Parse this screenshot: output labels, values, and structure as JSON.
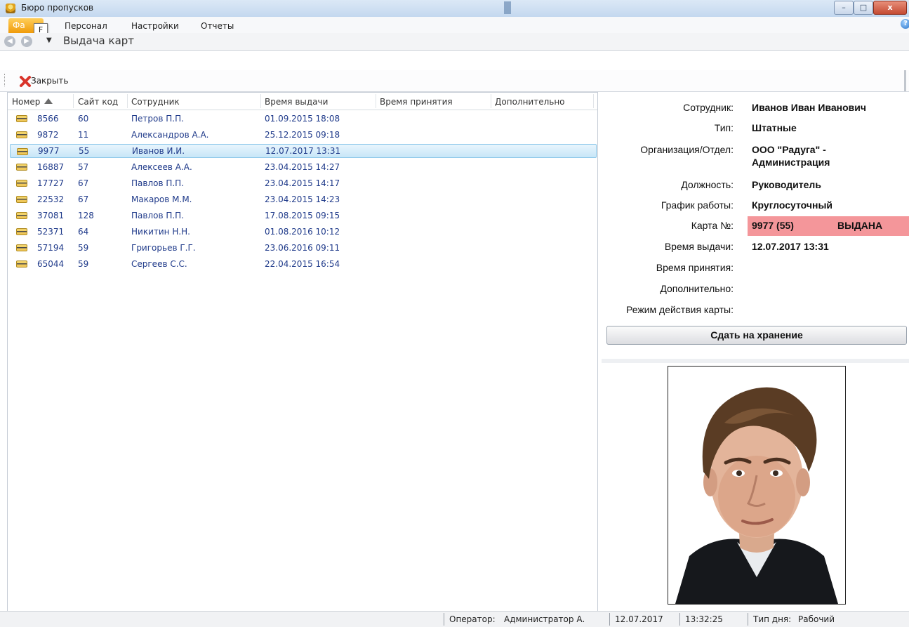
{
  "window": {
    "title": "Бюро пропусков"
  },
  "menu": {
    "file_label": "Фа",
    "file_keytip": "F",
    "tabs": [
      "Персонал",
      "Настройки",
      "Отчеты"
    ]
  },
  "navigation": {
    "page_title": "Выдача карт"
  },
  "toolbar": {
    "close_label": "Закрыть"
  },
  "grid": {
    "columns": [
      "Номер",
      "Сайт код",
      "Сотрудник",
      "Время выдачи",
      "Время принятия",
      "Дополнительно"
    ],
    "sort_column": "Номер",
    "rows": [
      {
        "number": "8566",
        "site": "60",
        "employee": "Петров П.П.",
        "issued": "01.09.2015 18:08"
      },
      {
        "number": "9872",
        "site": "11",
        "employee": "Александров А.А.",
        "issued": "25.12.2015 09:18"
      },
      {
        "number": "9977",
        "site": "55",
        "employee": "Иванов И.И.",
        "issued": "12.07.2017 13:31"
      },
      {
        "number": "16887",
        "site": "57",
        "employee": "Алексеев А.А.",
        "issued": "23.04.2015 14:27"
      },
      {
        "number": "17727",
        "site": "67",
        "employee": "Павлов П.П.",
        "issued": "23.04.2015 14:17"
      },
      {
        "number": "22532",
        "site": "67",
        "employee": "Макаров М.М.",
        "issued": "23.04.2015 14:23"
      },
      {
        "number": "37081",
        "site": "128",
        "employee": "Павлов П.П.",
        "issued": "17.08.2015 09:15"
      },
      {
        "number": "52371",
        "site": "64",
        "employee": "Никитин Н.Н.",
        "issued": "01.08.2016 10:12"
      },
      {
        "number": "57194",
        "site": "59",
        "employee": "Григорьев Г.Г.",
        "issued": "23.06.2016 09:11"
      },
      {
        "number": "65044",
        "site": "59",
        "employee": "Сергеев С.С.",
        "issued": "22.04.2015 16:54"
      }
    ],
    "selected_row": "9977"
  },
  "details": {
    "employee_label": "Сотрудник:",
    "employee_value": "Иванов Иван Иванович",
    "type_label": "Тип:",
    "type_value": "Штатные",
    "org_label": "Организация/Отдел:",
    "org_value_line1": "ООО \"Радуга\" -",
    "org_value_line2": "Администрация",
    "position_label": "Должность:",
    "position_value": "Руководитель",
    "schedule_label": "График работы:",
    "schedule_value": "Круглосуточный",
    "card_label": "Карта №:",
    "card_value": "9977 (55)",
    "card_status": "ВЫДАНА",
    "issued_label": "Время выдачи:",
    "issued_value": "12.07.2017 13:31",
    "accepted_label": "Время принятия:",
    "extra_label": "Дополнительно:",
    "mode_label": "Режим действия карты:",
    "store_button": "Сдать на хранение"
  },
  "colors": {
    "card_status_bg": "#f4969a",
    "row_text": "#1f3a8a",
    "selected_row_bg": "#c7e6f7"
  },
  "statusbar": {
    "operator_label": "Оператор:",
    "operator_value": "Администратор А.",
    "date": "12.07.2017",
    "time": "13:32:25",
    "daytype_label": "Тип дня:",
    "daytype_value": "Рабочий"
  }
}
